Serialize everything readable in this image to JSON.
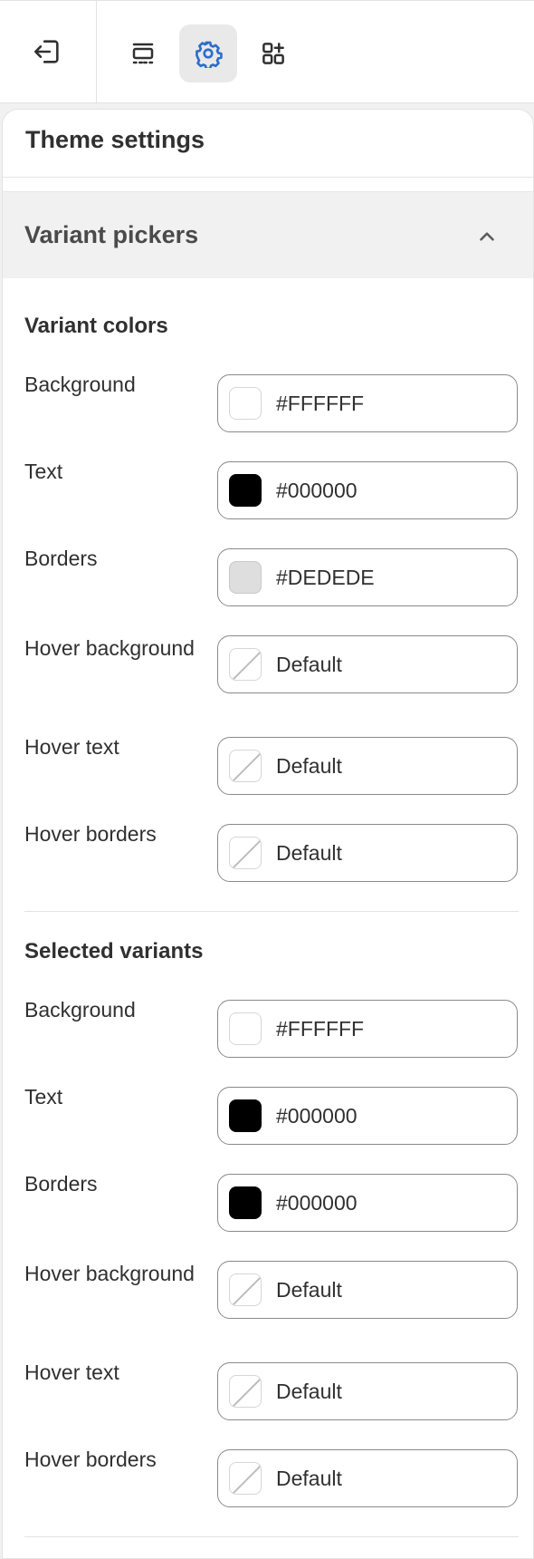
{
  "toolbar": {
    "exit_icon": "exit-icon",
    "tools": [
      {
        "name": "sections-icon"
      },
      {
        "name": "settings-gear-icon",
        "active": true
      },
      {
        "name": "apps-add-icon"
      }
    ],
    "accent_color": "#2c6ecb"
  },
  "panel": {
    "title": "Theme settings",
    "section": "Variant pickers",
    "groups": [
      {
        "title": "Variant colors",
        "rows": [
          {
            "label": "Background",
            "value": "#FFFFFF",
            "swatch": "#FFFFFF"
          },
          {
            "label": "Text",
            "value": "#000000",
            "swatch": "#000000"
          },
          {
            "label": "Borders",
            "value": "#DEDEDE",
            "swatch": "#DEDEDE"
          },
          {
            "label": "Hover background",
            "value": "Default",
            "swatch": "none"
          },
          {
            "label": "Hover text",
            "value": "Default",
            "swatch": "none"
          },
          {
            "label": "Hover borders",
            "value": "Default",
            "swatch": "none"
          }
        ]
      },
      {
        "title": "Selected variants",
        "rows": [
          {
            "label": "Background",
            "value": "#FFFFFF",
            "swatch": "#FFFFFF"
          },
          {
            "label": "Text",
            "value": "#000000",
            "swatch": "#000000"
          },
          {
            "label": "Borders",
            "value": "#000000",
            "swatch": "#000000"
          },
          {
            "label": "Hover background",
            "value": "Default",
            "swatch": "none"
          },
          {
            "label": "Hover text",
            "value": "Default",
            "swatch": "none"
          },
          {
            "label": "Hover borders",
            "value": "Default",
            "swatch": "none"
          }
        ]
      }
    ]
  }
}
